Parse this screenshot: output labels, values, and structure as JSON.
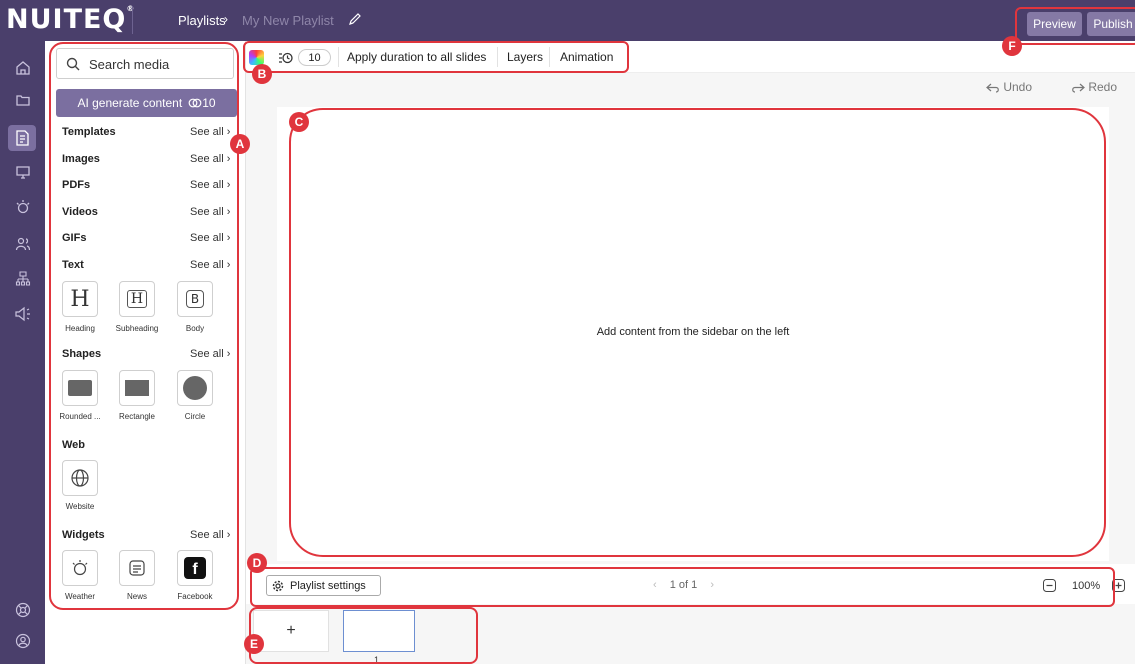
{
  "header": {
    "logo": "NUITEQ",
    "logo_mark": "®",
    "breadcrumb": {
      "root": "Playlists",
      "separator": "›",
      "current": "My New Playlist"
    },
    "preview_label": "Preview",
    "publish_label": "Publish"
  },
  "left_nav": {
    "icons": [
      "home-icon",
      "folder-icon",
      "playlist-icon",
      "display-icon",
      "weather-icon",
      "users-icon",
      "hierarchy-icon",
      "announce-icon",
      "help-icon",
      "account-icon"
    ]
  },
  "sidebar": {
    "search_placeholder": "Search media",
    "ai_button_label": "AI generate content",
    "ai_credits": "10",
    "see_all_label": "See all",
    "sections": {
      "templates": "Templates",
      "images": "Images",
      "pdfs": "PDFs",
      "videos": "Videos",
      "gifs": "GIFs",
      "text": "Text",
      "shapes": "Shapes",
      "web": "Web",
      "widgets": "Widgets"
    },
    "text_items": [
      "Heading",
      "Subheading",
      "Body"
    ],
    "shape_items": [
      "Rounded ...",
      "Rectangle",
      "Circle"
    ],
    "web_items": [
      "Website"
    ],
    "widget_items": [
      "Weather",
      "News",
      "Facebook"
    ]
  },
  "toolbar": {
    "duration": "10",
    "apply_duration_label": "Apply duration to all slides",
    "layers_label": "Layers",
    "animation_label": "Animation"
  },
  "editor": {
    "undo_label": "Undo",
    "redo_label": "Redo",
    "empty_message": "Add content from the sidebar on the left"
  },
  "bottombar": {
    "playlist_settings_label": "Playlist settings",
    "page_indicator": "1 of 1",
    "zoom_value": "100%"
  },
  "thumbnails": {
    "add_label": "+",
    "slide_numbers": [
      "1"
    ]
  },
  "annotations": [
    "A",
    "B",
    "C",
    "D",
    "E",
    "F"
  ],
  "colors": {
    "header_bg": "#4a3f6b",
    "accent": "#7b6fa0",
    "annotation_red": "#e0353d"
  }
}
